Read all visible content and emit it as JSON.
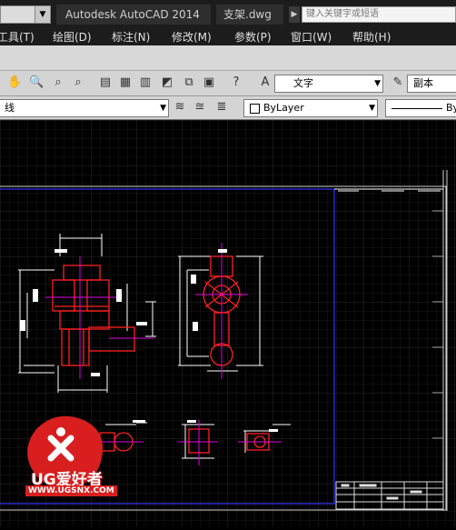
{
  "titlebar": {
    "app_title": "Autodesk AutoCAD 2014",
    "file_title": "支架.dwg",
    "search_placeholder": "键入关键字或短语"
  },
  "menu": {
    "items": [
      {
        "label": "工具(T)"
      },
      {
        "label": "绘图(D)"
      },
      {
        "label": "标注(N)"
      },
      {
        "label": "修改(M)"
      },
      {
        "label": "参数(P)"
      },
      {
        "label": "窗口(W)"
      },
      {
        "label": "帮助(H)"
      }
    ]
  },
  "toolbar": {
    "text_style": "文字",
    "text_style_right": "副本",
    "layer_name": "线",
    "color_value": "ByLayer",
    "linetype_value": "By"
  },
  "watermark": {
    "brand": "UG爱好者",
    "url": "WWW.UGSNX.COM"
  },
  "colors": {
    "canvas_bg": "#000000",
    "drawing_white": "#ffffff",
    "drawing_red": "#ff2020",
    "drawing_magenta": "#e000e0",
    "frame_blue": "#2828c8",
    "logo_red": "#d81e1e"
  }
}
